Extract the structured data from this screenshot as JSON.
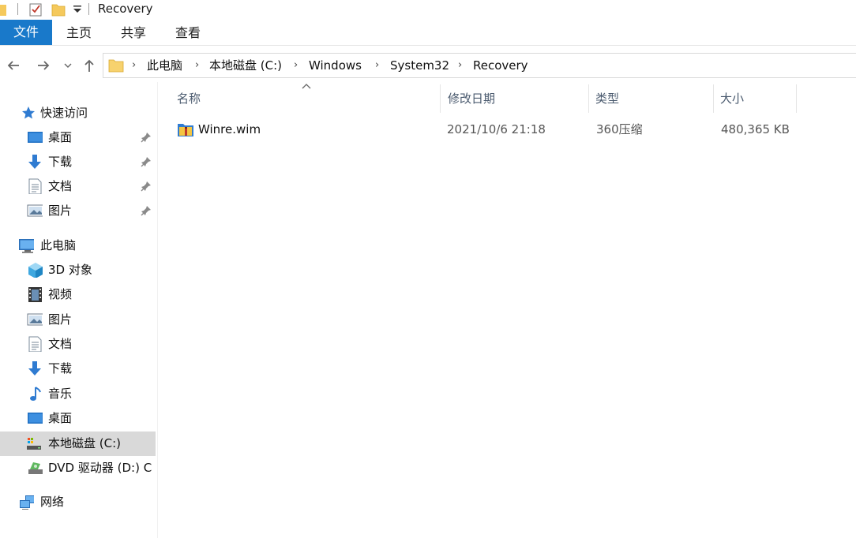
{
  "window": {
    "title": "Recovery"
  },
  "ribbon": {
    "tabs": [
      "文件",
      "主页",
      "共享",
      "查看"
    ]
  },
  "address": {
    "crumbs": [
      "此电脑",
      "本地磁盘 (C:)",
      "Windows",
      "System32",
      "Recovery"
    ]
  },
  "sidebar": {
    "quick_access": {
      "label": "快速访问",
      "items": [
        "桌面",
        "下载",
        "文档",
        "图片"
      ]
    },
    "this_pc": {
      "label": "此电脑",
      "items": [
        "3D 对象",
        "视频",
        "图片",
        "文档",
        "下载",
        "音乐",
        "桌面",
        "本地磁盘 (C:)",
        "DVD 驱动器 (D:) C"
      ]
    },
    "network": {
      "label": "网络"
    }
  },
  "columns": {
    "name": "名称",
    "date": "修改日期",
    "type": "类型",
    "size": "大小"
  },
  "files": [
    {
      "name": "Winre.wim",
      "date": "2021/10/6 21:18",
      "type": "360压缩",
      "size": "480,365 KB"
    }
  ],
  "colors": {
    "accent": "#1979ca",
    "selected_bg": "#d9d9d9"
  }
}
